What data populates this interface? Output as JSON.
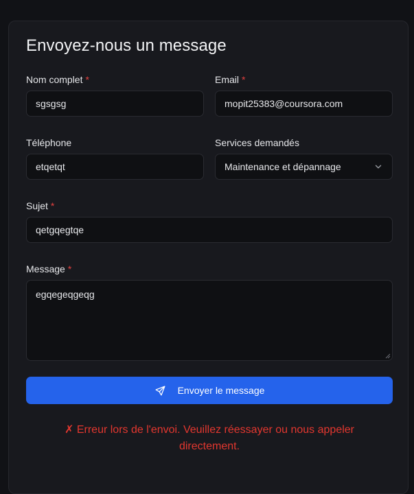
{
  "form": {
    "title": "Envoyez-nous un message",
    "required_marker": "*",
    "fields": {
      "name": {
        "label": "Nom complet",
        "value": "sgsgsg"
      },
      "email": {
        "label": "Email",
        "value": "mopit25383@coursora.com"
      },
      "phone": {
        "label": "Téléphone",
        "value": "etqetqt"
      },
      "services": {
        "label": "Services demandés",
        "value": "Maintenance et dépannage"
      },
      "subject": {
        "label": "Sujet",
        "value": "qetgqegtqe"
      },
      "message": {
        "label": "Message",
        "value": "egqegeqgeqg"
      }
    },
    "submit_label": "Envoyer le message",
    "error_line1": "✗ Erreur lors de l'envoi. Veuillez réessayer ou nous appeler",
    "error_line2": "directement."
  },
  "colors": {
    "page_bg": "#111216",
    "card_bg": "#18191e",
    "input_bg": "#0f1013",
    "accent": "#2563eb",
    "required": "#e2403f",
    "error": "#e3372f"
  },
  "icons": {
    "submit": "send-icon",
    "select": "chevron-down-icon",
    "textarea": "resize-handle-icon"
  }
}
